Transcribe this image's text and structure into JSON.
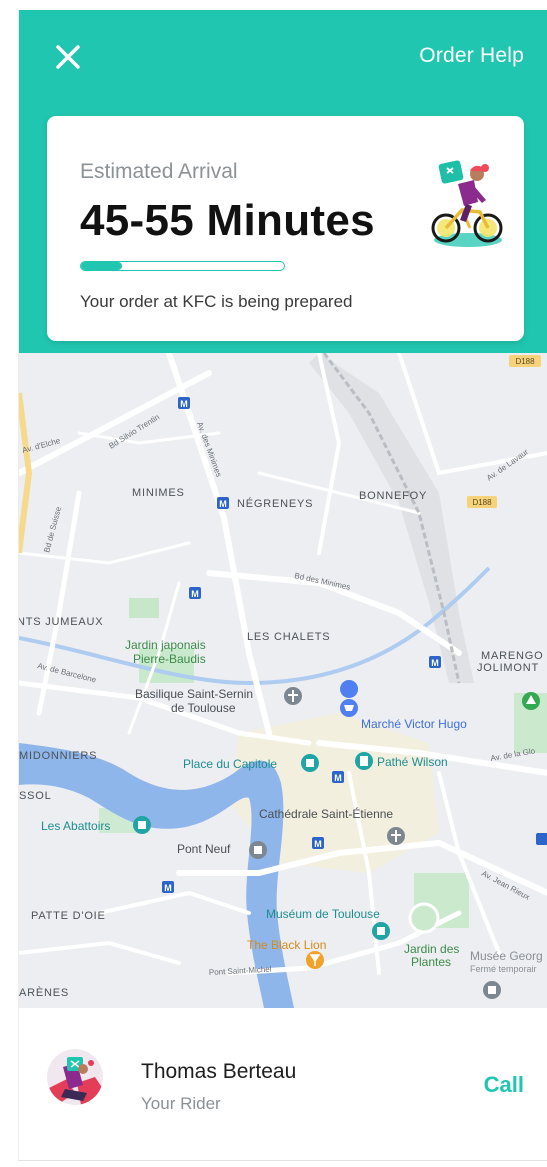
{
  "header": {
    "close_icon": "close-icon",
    "help_label": "Order Help",
    "background_color": "#21c6b0"
  },
  "arrival_card": {
    "label": "Estimated Arrival",
    "time_range": "45-55 Minutes",
    "progress_fraction": 0.2,
    "status": "Your order at KFC is being prepared",
    "illustration_icon": "delivery-bike-icon"
  },
  "map": {
    "labels": {
      "minimes": "MINIMES",
      "negreneys": "NÉGRENEYS",
      "bonnefoy": "BONNEFOY",
      "jumeaux": "NTS JUMEAUX",
      "les_chalets": "LES CHALETS",
      "marengo": "MARENGO",
      "jolimont": "JOLIMONT",
      "jardin_1": "Jardin japonais",
      "jardin_2": "Pierre-Baudis",
      "basilique_1": "Basilique Saint-Sernin",
      "basilique_2": "de Toulouse",
      "marche": "Marché Victor Hugo",
      "midonniers": "MIDONNIERS",
      "ssol": "SSOL",
      "capitole": "Place du Capitole",
      "pathe": "Pathé Wilson",
      "abattoirs": "Les Abattoirs",
      "cathedrale": "Cathédrale Saint-Étienne",
      "pont_neuf": "Pont Neuf",
      "patte_doie": "PATTE D'OIE",
      "museum": "Muséum de Toulouse",
      "black_lion": "The Black Lion",
      "jardin_plantes_1": "Jardin des",
      "jardin_plantes_2": "Plantes",
      "musee_geor": "Musée Georg",
      "ferme": "Fermé temporair",
      "arenes": "ARÈNES",
      "bd_silvio": "Bd Silvio Trentin",
      "av_minimes": "Av. des Minimes",
      "bd_minimes": "Bd des Minimes",
      "bd_suisse": "Bd de Suisse",
      "av_elche": "Av. d'Elche",
      "av_barcelone": "Av. de Barcelone",
      "av_gloire": "Av. de la Glo",
      "av_lavaur": "Av. de Lavaur",
      "av_jean_rieux": "Av. Jean Rieux",
      "pont_saint_michel": "Pont Saint-Michel",
      "d188_a": "D188",
      "d188_b": "D188",
      "metro": "M"
    }
  },
  "rider": {
    "name": "Thomas Berteau",
    "role": "Your Rider",
    "call_label": "Call",
    "avatar_icon": "rider-avatar"
  }
}
